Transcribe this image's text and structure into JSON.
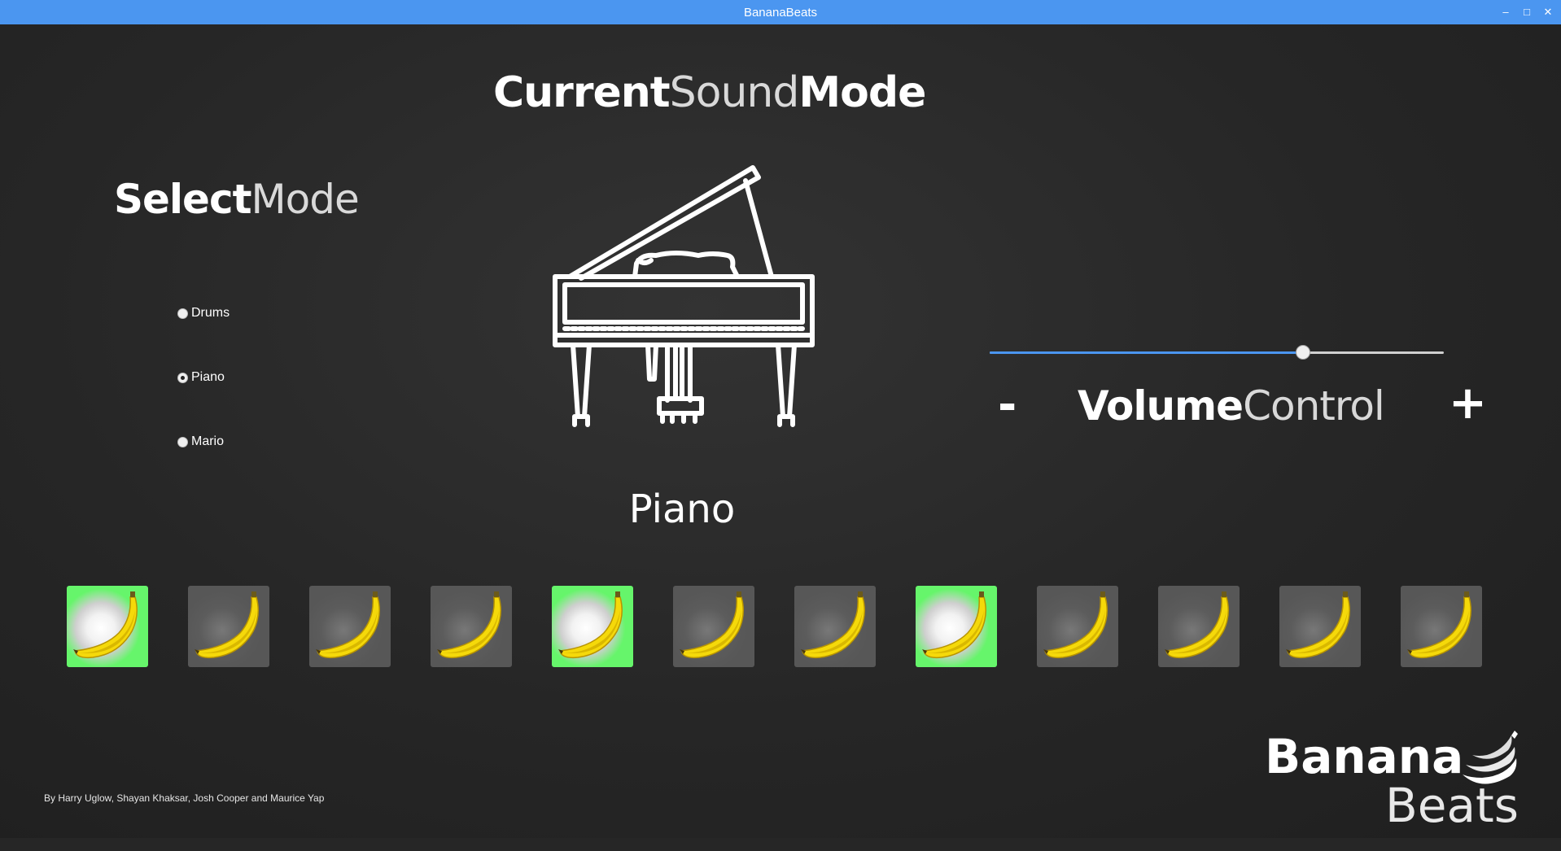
{
  "window": {
    "title": "BananaBeats",
    "controls": {
      "minimize": "‒",
      "maximize": "□",
      "close": "✕"
    }
  },
  "current_sound": {
    "heading_bold": "Current",
    "heading_light": "Sound",
    "heading_bold_2": "Mode",
    "mode_name": "Piano",
    "icon": "grand-piano-icon"
  },
  "select_mode": {
    "heading_bold": "Select",
    "heading_light": "Mode",
    "options": [
      {
        "label": "Drums",
        "selected": false
      },
      {
        "label": "Piano",
        "selected": true
      },
      {
        "label": "Mario",
        "selected": false
      }
    ]
  },
  "volume": {
    "heading_bold": "Volume",
    "heading_light": "Control",
    "minus_label": "-",
    "plus_label": "+",
    "level": 0.69
  },
  "pads": {
    "icon": "banana-icon",
    "items": [
      {
        "active": true
      },
      {
        "active": false
      },
      {
        "active": false
      },
      {
        "active": false
      },
      {
        "active": true
      },
      {
        "active": false
      },
      {
        "active": false
      },
      {
        "active": true
      },
      {
        "active": false
      },
      {
        "active": false
      },
      {
        "active": false
      },
      {
        "active": false
      }
    ]
  },
  "brand": {
    "top": "Banana",
    "bottom": "Beats",
    "icon": "banana-bunch-icon"
  },
  "credits": "By Harry Uglow, Shayan Khaksar, Josh Cooper and Maurice Yap",
  "colors": {
    "titlebar": "#4b96f0",
    "background": "#262626",
    "pad_active": "#66f56b",
    "pad_inactive": "#575757",
    "slider_fill": "#4b96f0",
    "banana": "#f5d90a"
  }
}
